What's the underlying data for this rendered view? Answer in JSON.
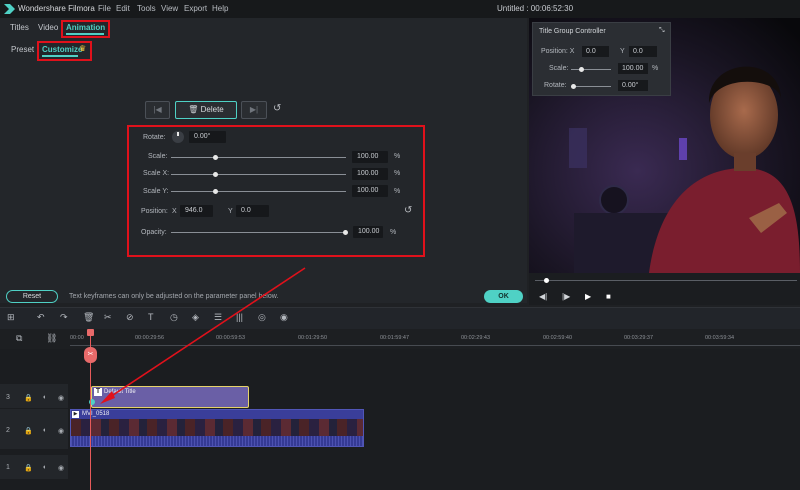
{
  "app": {
    "title": "Wondershare Filmora",
    "document_title": "Untitled : 00:06:52:30"
  },
  "menu": [
    "File",
    "Edit",
    "Tools",
    "View",
    "Export",
    "Help"
  ],
  "top_tabs": {
    "titles": "Titles",
    "video": "Video",
    "animation": "Animation"
  },
  "sub_tabs": {
    "preset": "Preset",
    "customize": "Customize"
  },
  "keyframe": {
    "prev": "|◀",
    "delete": "Delete",
    "next": "▶|",
    "reset_icon": "undo-icon"
  },
  "params": {
    "rotate": {
      "label": "Rotate:",
      "value": "0.00°"
    },
    "scale": {
      "label": "Scale:",
      "value": "100.00",
      "unit": "%"
    },
    "scale_x": {
      "label": "Scale X:",
      "value": "100.00",
      "unit": "%"
    },
    "scale_y": {
      "label": "Scale Y:",
      "value": "100.00",
      "unit": "%"
    },
    "position": {
      "label": "Position:",
      "x_label": "X",
      "x": "946.0",
      "y_label": "Y",
      "y": "0.0"
    },
    "opacity": {
      "label": "Opacity:",
      "value": "100.00",
      "unit": "%"
    }
  },
  "footer": {
    "reset": "Reset",
    "hint": "Text keyframes can only be adjusted on the parameter panel below.",
    "ok": "OK"
  },
  "title_group_controller": {
    "title": "Title Group Controller",
    "position_label": "Position: X",
    "x": "0.0",
    "y_label": "Y",
    "y": "0.0",
    "scale_label": "Scale:",
    "scale": "100.00",
    "scale_unit": "%",
    "rotate_label": "Rotate:",
    "rotate": "0.00°"
  },
  "ruler_ticks": [
    "00:00",
    "00:00:29:56",
    "00:00:59:53",
    "00:01:29:50",
    "00:01:59:47",
    "00:02:29:43",
    "00:02:59:40",
    "00:03:29:37",
    "00:03:59:34"
  ],
  "tracks": {
    "t3": "3",
    "t2": "2",
    "t1": "1",
    "title_clip": "Default Title",
    "video_clip": "MVI_0518"
  },
  "colors": {
    "accent": "#4fd1c5",
    "highlight": "#e0111b",
    "clip_title": "#6a5fa6",
    "clip_video": "#3a3e9a"
  }
}
